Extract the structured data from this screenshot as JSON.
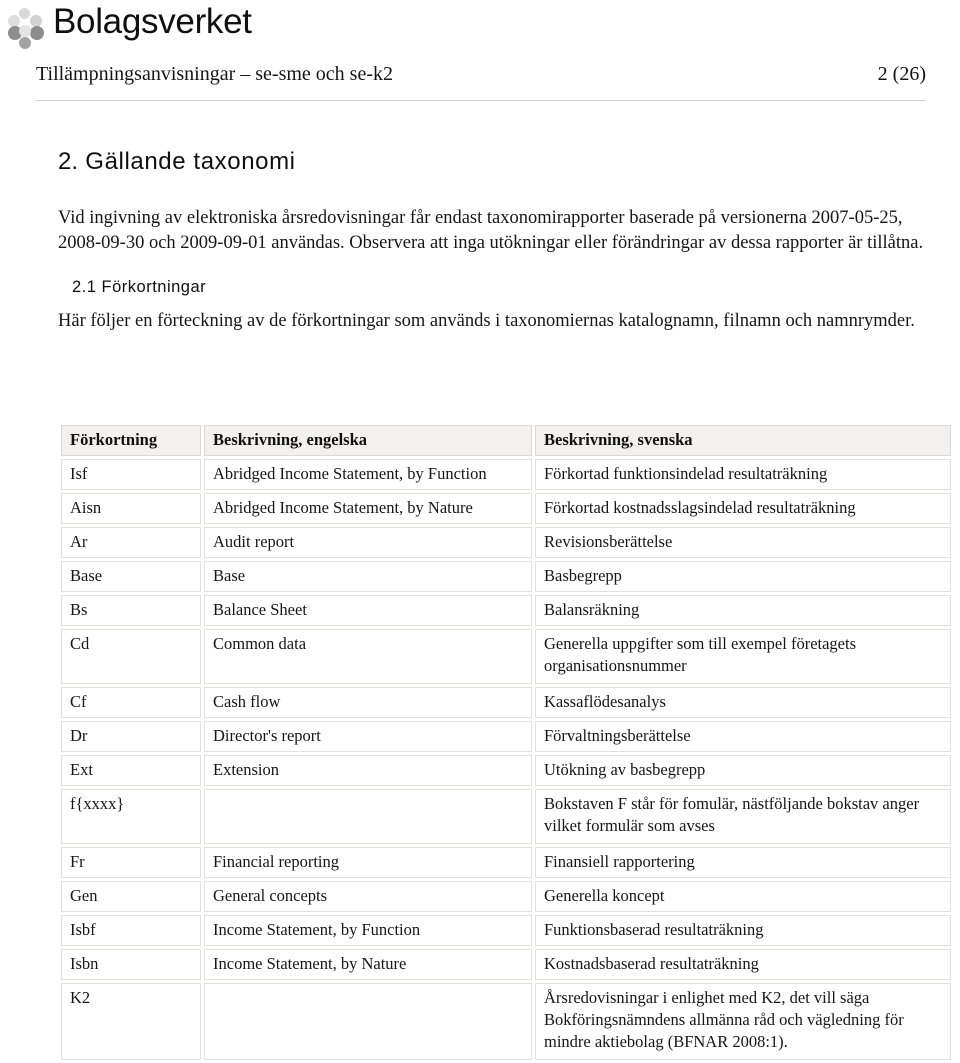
{
  "brand": {
    "name": "Bolagsverket",
    "logo_icon": "bolagsverket-dots-logo",
    "dot_colors": [
      "#d6d6d6",
      "#dcdcdc",
      "#8e8e8e",
      "#c8c8c8",
      "#9a9a9a",
      "#9a9a9a",
      "#a8a8a8"
    ]
  },
  "header": {
    "title": "Tillämpningsanvisningar – se-sme och se-k2",
    "page_label": "2 (26)"
  },
  "section": {
    "number": "2.",
    "title": "Gällande taxonomi",
    "paragraph": "Vid ingivning av elektroniska årsredovisningar får endast taxonomirapporter baserade på versionerna 2007-05-25, 2008-09-30 och 2009-09-01 användas. Observera att inga utökningar eller förändringar av dessa rapporter är tillåtna."
  },
  "subsection": {
    "number": "2.1",
    "title": "Förkortningar",
    "paragraph": "Här följer en förteckning av de förkortningar som används i taxonomiernas katalognamn, filnamn och namnrymder."
  },
  "table": {
    "headers": [
      "Förkortning",
      "Beskrivning, engelska",
      "Beskrivning, svenska"
    ],
    "rows": [
      {
        "abbr": "Isf",
        "en": "Abridged Income Statement, by Function",
        "sv": "Förkortad funktionsindelad resultaträkning",
        "lines": 1
      },
      {
        "abbr": "Aisn",
        "en": "Abridged Income Statement, by Nature",
        "sv": "Förkortad kostnadsslagsindelad resultaträkning",
        "lines": 1
      },
      {
        "abbr": "Ar",
        "en": "Audit report",
        "sv": "Revisionsberättelse",
        "lines": 1
      },
      {
        "abbr": "Base",
        "en": "Base",
        "sv": "Basbegrepp",
        "lines": 1
      },
      {
        "abbr": "Bs",
        "en": "Balance Sheet",
        "sv": "Balansräkning",
        "lines": 1
      },
      {
        "abbr": "Cd",
        "en": "Common data",
        "sv": "Generella uppgifter som till exempel företagets organisationsnummer",
        "lines": 2
      },
      {
        "abbr": "Cf",
        "en": "Cash flow",
        "sv": "Kassaflödesanalys",
        "lines": 1
      },
      {
        "abbr": "Dr",
        "en": "Director's report",
        "sv": "Förvaltningsberättelse",
        "lines": 1
      },
      {
        "abbr": "Ext",
        "en": "Extension",
        "sv": "Utökning av basbegrepp",
        "lines": 1
      },
      {
        "abbr": "f{xxxx}",
        "en": "",
        "sv": "Bokstaven F står för fomulär, nästföljande bokstav anger vilket formulär som avses",
        "lines": 2
      },
      {
        "abbr": "Fr",
        "en": "Financial reporting",
        "sv": "Finansiell rapportering",
        "lines": 1
      },
      {
        "abbr": "Gen",
        "en": "General concepts",
        "sv": "Generella koncept",
        "lines": 1
      },
      {
        "abbr": "Isbf",
        "en": "Income Statement, by Function",
        "sv": "Funktionsbaserad resultaträkning",
        "lines": 1
      },
      {
        "abbr": "Isbn",
        "en": "Income Statement, by Nature",
        "sv": "Kostnadsbaserad resultaträkning",
        "lines": 1
      },
      {
        "abbr": "K2",
        "en": "",
        "sv": "Årsredovisningar i enlighet med K2, det vill säga Bokföringsnämndens allmänna råd och vägledning för mindre aktiebolag (BFNAR 2008:1).",
        "lines": 3
      }
    ]
  }
}
